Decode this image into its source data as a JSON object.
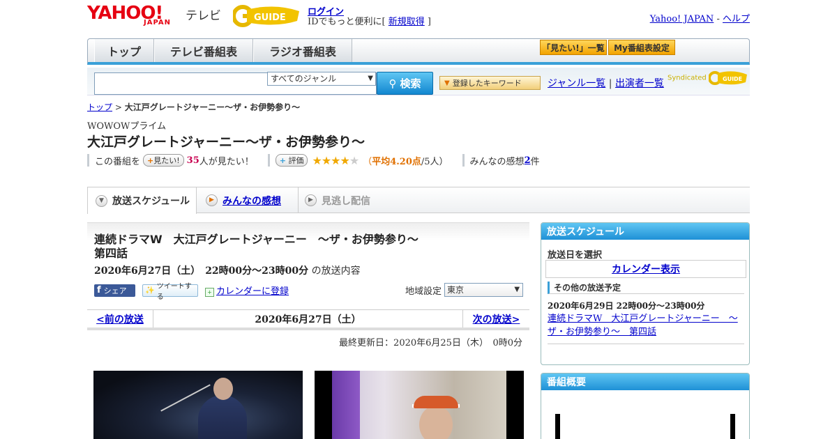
{
  "header": {
    "logo_yahoo": "YAHOO!",
    "logo_japan": "JAPAN",
    "logo_tv": "テレビ",
    "gguide_logo": "G-GUIDE",
    "login_label": "ログイン",
    "login_sub_prefix": "IDでもっと便利に[ ",
    "register_label": "新規取得",
    "login_sub_suffix": " ]",
    "yahoo_japan_link": "Yahoo! JAPAN",
    "separator": " - ",
    "help_link": "ヘルプ"
  },
  "nav": {
    "tabs": [
      "トップ",
      "テレビ番組表",
      "ラジオ番組表"
    ],
    "want_list": "「見たい!」一覧",
    "my_schedule": "My番組表設定"
  },
  "search": {
    "genre_selected": "すべてのジャンル",
    "search_button": "検索",
    "keyword_button": "登録したキーワード",
    "genre_list_link": "ジャンル一覧",
    "divider": " | ",
    "cast_list_link": "出演者一覧",
    "syndicated": "Syndicated"
  },
  "breadcrumb": {
    "home": "トップ",
    "sep": " > ",
    "current": "大江戸グレートジャーニー～ザ・お伊勢参り～"
  },
  "program": {
    "channel": "WOWOWプライム",
    "title": "大江戸グレートジャーニー～ザ・お伊勢参り～",
    "want_prefix": "この番組を",
    "want_button": "見たい!",
    "want_count": "35",
    "want_suffix": "人が見たい！",
    "rate_button": "評価",
    "stars": "★★★★",
    "stars_off": "★",
    "rating_open": "（",
    "rating_avg": "平均4.20点",
    "rating_count": "/5人）",
    "impressions_prefix": "みんなの感想 ",
    "impressions_count": "2",
    "impressions_suffix": "件",
    "star_rating": 4.2
  },
  "tabs": {
    "schedule": "放送スケジュール",
    "impressions": "みんなの感想",
    "vod": "見逃し配信"
  },
  "episode": {
    "title": "連続ドラマW　大江戸グレートジャーニー　～ザ・お伊勢参り～第四話",
    "date_time": "2020年6月27日（土）　22時00分～23時00分",
    "date_suffix": "の放送内容",
    "share": "シェア",
    "tweet": "ツイートする",
    "calendar_register": "カレンダーに登録",
    "region_label": "地域設定",
    "region_value": "東京"
  },
  "pager": {
    "prev": "<前の放送",
    "current": "2020年6月27日（土）",
    "next": "次の放送>"
  },
  "updated": "最終更新日：2020年6月25日（木）　0時0分",
  "sidebar": {
    "schedule_head": "放送スケジュール",
    "select_date": "放送日を選択",
    "calendar_button": "カレンダー表示",
    "other_head": "その他の放送予定",
    "other_date": "2020年6月29日  22時00分～23時00分",
    "other_link": "連続ドラマW　大江戸グレートジャーニー　～ザ・お伊勢参り～　第四話",
    "summary_head": "番組概要"
  },
  "colors": {
    "accent_blue": "#3aa0d8",
    "yahoo_red": "#e60012",
    "link": "#0000cc",
    "star": "#f0a800"
  }
}
